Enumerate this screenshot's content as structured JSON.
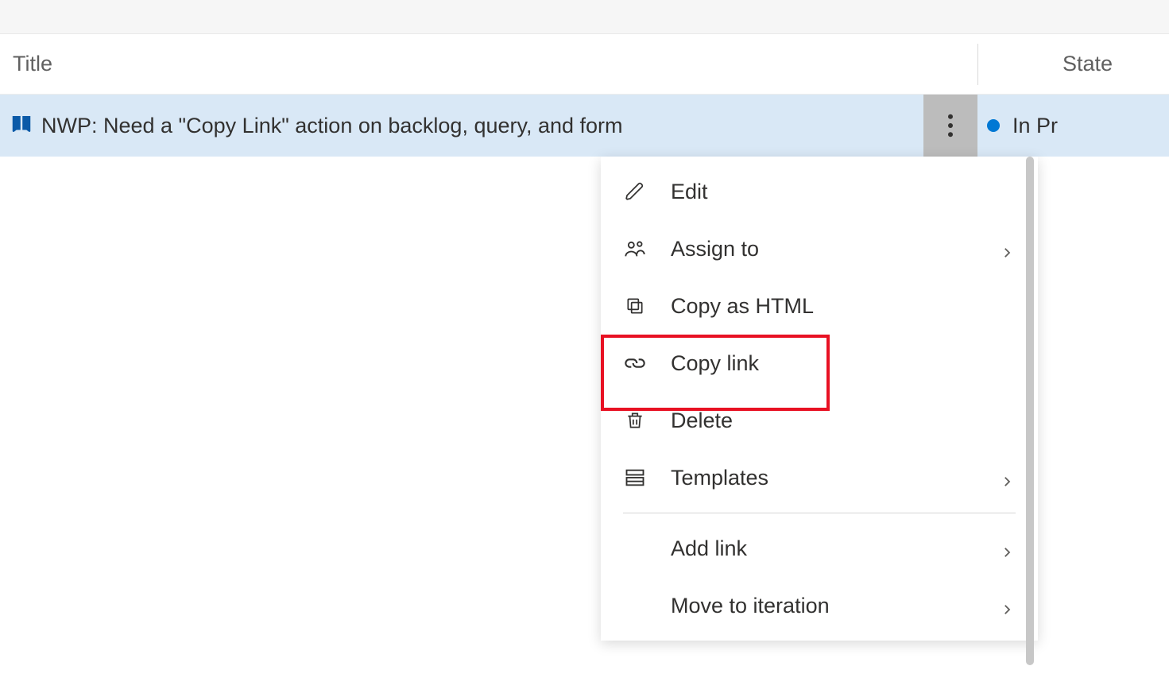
{
  "columns": {
    "title": "Title",
    "state": "State"
  },
  "item": {
    "title": "NWP: Need a \"Copy Link\" action on backlog, query, and form",
    "state": "In Pr",
    "state_color": "#0078d4"
  },
  "menu": {
    "items": [
      {
        "key": "edit",
        "label": "Edit",
        "icon": "edit-icon",
        "has_submenu": false
      },
      {
        "key": "assign-to",
        "label": "Assign to",
        "icon": "people-icon",
        "has_submenu": true
      },
      {
        "key": "copy-as-html",
        "label": "Copy as HTML",
        "icon": "copy-icon",
        "has_submenu": false
      },
      {
        "key": "copy-link",
        "label": "Copy link",
        "icon": "link-icon",
        "has_submenu": false,
        "highlighted": true
      },
      {
        "key": "delete",
        "label": "Delete",
        "icon": "trash-icon",
        "has_submenu": false
      },
      {
        "key": "templates",
        "label": "Templates",
        "icon": "templates-icon",
        "has_submenu": true
      }
    ],
    "secondary_items": [
      {
        "key": "add-link",
        "label": "Add link",
        "has_submenu": true
      },
      {
        "key": "move-to-iteration",
        "label": "Move to iteration",
        "has_submenu": true
      }
    ]
  }
}
